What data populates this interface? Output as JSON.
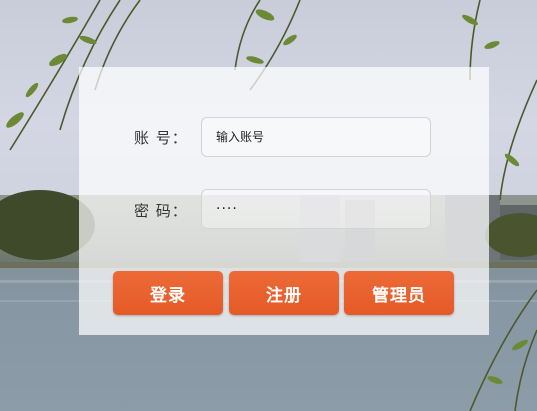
{
  "login": {
    "account_label": "账  号：",
    "password_label": "密  码：",
    "account_placeholder": "输入账号",
    "password_value": "····"
  },
  "buttons": {
    "login": "登录",
    "register": "注册",
    "admin": "管理员"
  },
  "colors": {
    "button_orange": "#e55a27",
    "panel_white": "#ffffff"
  }
}
